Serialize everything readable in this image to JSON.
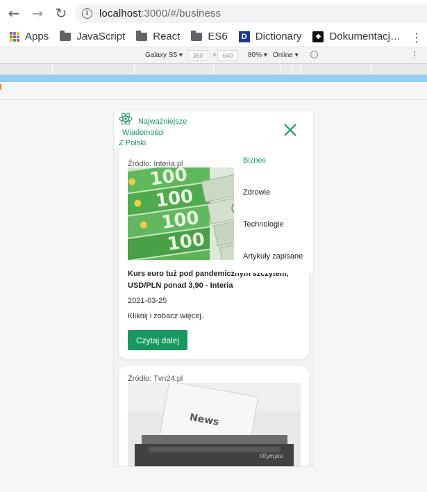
{
  "browser": {
    "url_host": "localhost",
    "url_rest": ":3000/#/business",
    "bookmarks": [
      {
        "label": "Apps",
        "icon": "apps-grid-icon"
      },
      {
        "label": "JavaScript",
        "icon": "folder-icon"
      },
      {
        "label": "React",
        "icon": "folder-icon"
      },
      {
        "label": "ES6",
        "icon": "folder-icon"
      },
      {
        "label": "Dictionary",
        "icon": "dictionary-icon"
      },
      {
        "label": "Dokumentacj…",
        "icon": "docs-icon"
      }
    ]
  },
  "devtools": {
    "device": "Galaxy S5 ▾",
    "width": "360",
    "height": "640",
    "zoom": "80% ▾",
    "network": "Online ▾"
  },
  "app": {
    "brand_line1": "Najważniejsze",
    "brand_line2": "Wiadomości",
    "brand_line3": "Z Polski",
    "accent_color": "#1a9463",
    "menu": [
      {
        "label": "Biznes",
        "active": true
      },
      {
        "label": "Zdrowie",
        "active": false
      },
      {
        "label": "Technologie",
        "active": false
      },
      {
        "label": "Artykuły zapisane",
        "active": false
      }
    ],
    "articles": [
      {
        "source": "Źródło: Interia.pl",
        "title": "Kurs euro tuż pod pandemicznym szczytem, USD/PLN ponad 3,90 - Interia",
        "date": "2021-03-25",
        "description": "Kliknij i zobacz więcej.",
        "button": "Czytaj dalej",
        "image": "euro-banknotes"
      },
      {
        "source": "Źródło: Tvn24.pl",
        "image": "typewriter-news"
      }
    ],
    "image_text": {
      "banknote_value": "100",
      "paper_word": "News",
      "brand_word": "Olympia"
    }
  }
}
